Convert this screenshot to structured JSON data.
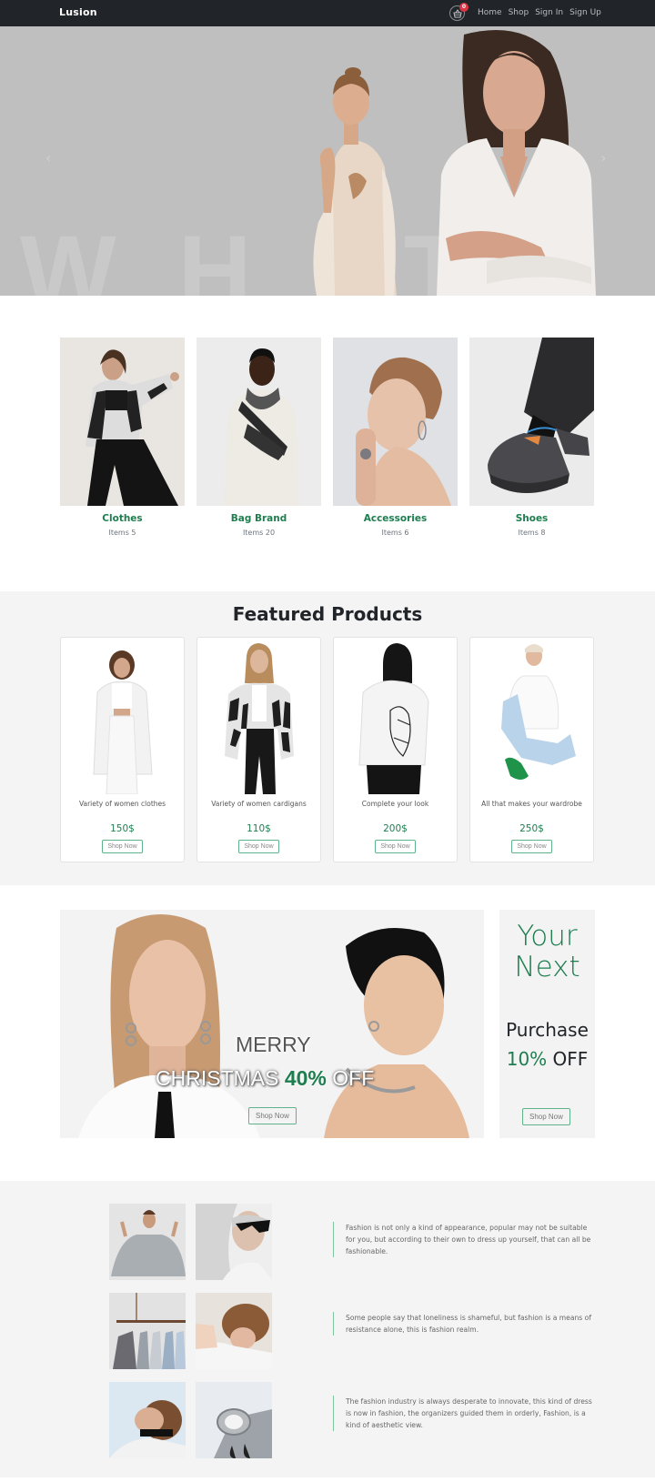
{
  "navbar": {
    "brand": "Lusion",
    "cart_icon": "shopping-basket-icon",
    "cart_count": "0",
    "links": [
      "Home",
      "Shop",
      "Sign In",
      "Sign Up"
    ]
  },
  "hero": {
    "background_word": "WHITE",
    "prev_icon": "chevron-left-icon",
    "next_icon": "chevron-right-icon",
    "prev_glyph": "‹",
    "next_glyph": "›"
  },
  "categories": [
    {
      "title": "Clothes",
      "count": "Items 5"
    },
    {
      "title": "Bag Brand",
      "count": "Items 20"
    },
    {
      "title": "Accessories",
      "count": "Items 6"
    },
    {
      "title": "Shoes",
      "count": "Items 8"
    }
  ],
  "featured": {
    "title": "Featured Products",
    "products": [
      {
        "description": "Variety of women clothes",
        "price": "150$",
        "button": "Shop Now"
      },
      {
        "description": "Variety of women cardigans",
        "price": "110$",
        "button": "Shop Now"
      },
      {
        "description": "Complete your look",
        "price": "200$",
        "button": "Shop Now"
      },
      {
        "description": "All that makes your wardrobe",
        "price": "250$",
        "button": "Shop Now"
      }
    ]
  },
  "promo": {
    "line1": "MERRY",
    "line2_prefix": "CHRISTMAS ",
    "line2_accent": "40%",
    "line2_suffix": " OFF",
    "button": "Shop Now",
    "side": {
      "line1": "Your",
      "line2": "Next",
      "line3": "Purchase",
      "discount": "10%",
      "off": " OFF",
      "button": "Shop Now"
    }
  },
  "quotes": [
    "Fashion is not only a kind of appearance, popular may not be suitable for you, but according to their own to dress up yourself, that can all be fashionable.",
    "Some people say that loneliness is shameful, but fashion is a means of resistance alone, this is fashion realm.",
    "The fashion industry is always desperate to innovate, this kind of dress is now in fashion, the organizers guided them in orderly, Fashion, is a kind of aesthetic view."
  ],
  "colors": {
    "accent": "#1e7e4f",
    "navbar": "#212529",
    "badge": "#dc3545",
    "section_grey": "#f4f4f4"
  }
}
